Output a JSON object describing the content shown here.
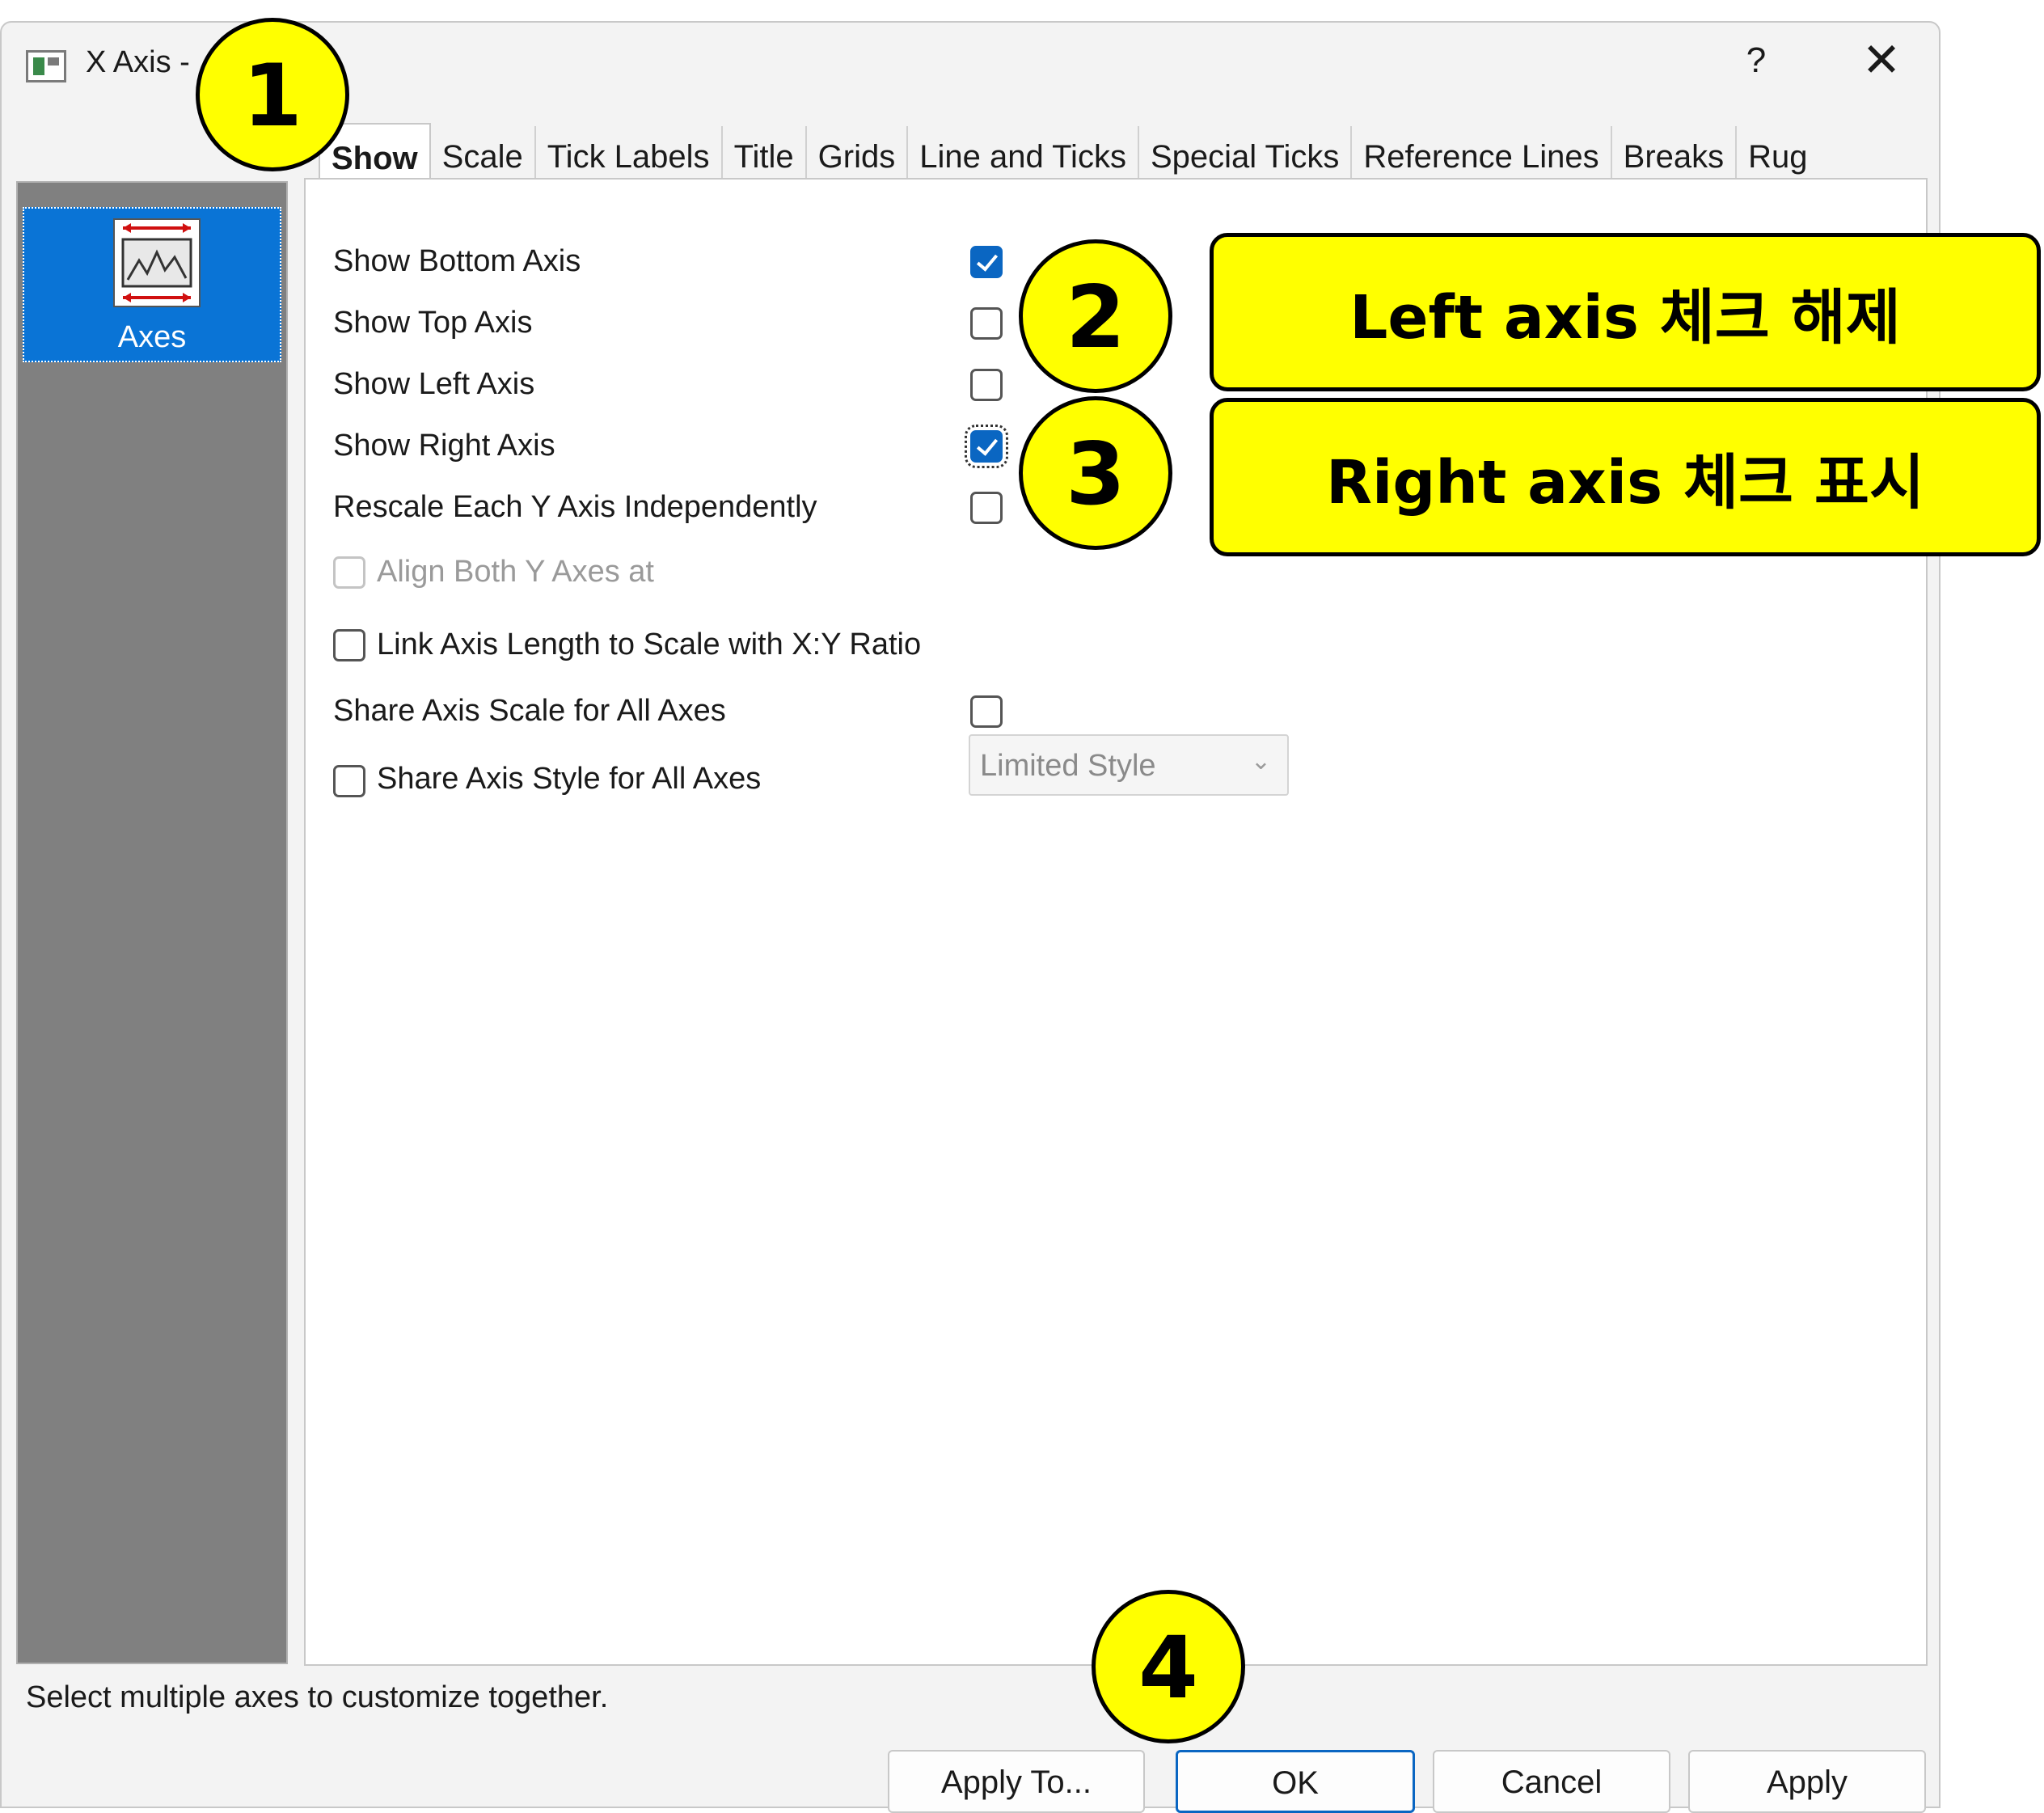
{
  "window": {
    "title": "X Axis -",
    "help_label": "?",
    "close_label": "✕"
  },
  "tabs": [
    {
      "label": "Show",
      "active": true
    },
    {
      "label": "Scale"
    },
    {
      "label": "Tick Labels"
    },
    {
      "label": "Title"
    },
    {
      "label": "Grids"
    },
    {
      "label": "Line and Ticks"
    },
    {
      "label": "Special Ticks"
    },
    {
      "label": "Reference Lines"
    },
    {
      "label": "Breaks"
    },
    {
      "label": "Rug"
    }
  ],
  "sidebar": {
    "items": [
      {
        "label": "Axes",
        "selected": true,
        "icon": "axes-plot-icon"
      }
    ]
  },
  "options": {
    "show_bottom_axis": {
      "label": "Show Bottom Axis",
      "checked": true
    },
    "show_top_axis": {
      "label": "Show Top Axis",
      "checked": false
    },
    "show_left_axis": {
      "label": "Show Left Axis",
      "checked": false
    },
    "show_right_axis": {
      "label": "Show Right Axis",
      "checked": true
    },
    "rescale_each_y": {
      "label": "Rescale Each Y Axis Independently",
      "checked": false
    },
    "align_both_y": {
      "label": "Align Both Y Axes at",
      "checked": false,
      "disabled": true
    },
    "link_axis_length": {
      "label": "Link Axis Length to Scale with X:Y Ratio",
      "checked": false
    },
    "share_axis_scale": {
      "label": "Share Axis Scale for All Axes",
      "checked": false
    },
    "share_axis_style": {
      "label": "Share Axis Style for All Axes",
      "checked": false
    },
    "style_combo": {
      "value": "Limited Style",
      "disabled": true
    }
  },
  "status": {
    "text": "Select multiple axes to customize together."
  },
  "buttons": {
    "apply_to": "Apply To...",
    "ok": "OK",
    "cancel": "Cancel",
    "apply": "Apply"
  },
  "annotations": {
    "step1": "1",
    "step2": "2",
    "step3": "3",
    "step4": "4",
    "note2": "Left axis 체크 해제",
    "note3": "Right axis 체크 표시"
  },
  "colors": {
    "accent": "#0a66c2",
    "sidebar_selected": "#0a74d6",
    "callout": "#ffff00"
  }
}
